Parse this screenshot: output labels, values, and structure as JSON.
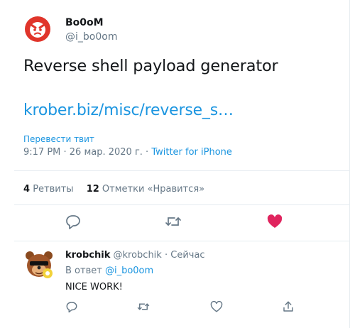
{
  "tweet": {
    "author_name": "Bo0oM",
    "author_handle": "@i_bo0om",
    "text": "Reverse shell payload generator",
    "link": "krober.biz/misc/reverse_s…",
    "translate_label": "Перевести твит",
    "time": "9:17 PM · 26 мар. 2020 г. · ",
    "source": "Twitter for iPhone",
    "retweets_count": "4",
    "retweets_label": "Ретвиты",
    "likes_count": "12",
    "likes_label": "Отметки «Нравится»",
    "colors": {
      "accent": "#1b95e0",
      "like": "#e0245e",
      "muted": "#657786",
      "avatar": "#e0352b"
    },
    "actions": [
      {
        "name": "reply",
        "icon": "reply-icon"
      },
      {
        "name": "retweet",
        "icon": "retweet-icon"
      },
      {
        "name": "like",
        "icon": "heart-filled-icon",
        "active": true
      }
    ]
  },
  "reply": {
    "author_name": "krobchik",
    "author_handle": "@krobchik",
    "separator": "·",
    "time": "Сейчас",
    "in_reply_to_label": "В ответ",
    "in_reply_to_handle": "@i_bo0om",
    "text": "NICE WORK!",
    "actions": [
      {
        "name": "reply",
        "icon": "reply-icon"
      },
      {
        "name": "retweet",
        "icon": "retweet-icon"
      },
      {
        "name": "like",
        "icon": "heart-outline-icon"
      },
      {
        "name": "share",
        "icon": "share-icon"
      }
    ]
  }
}
